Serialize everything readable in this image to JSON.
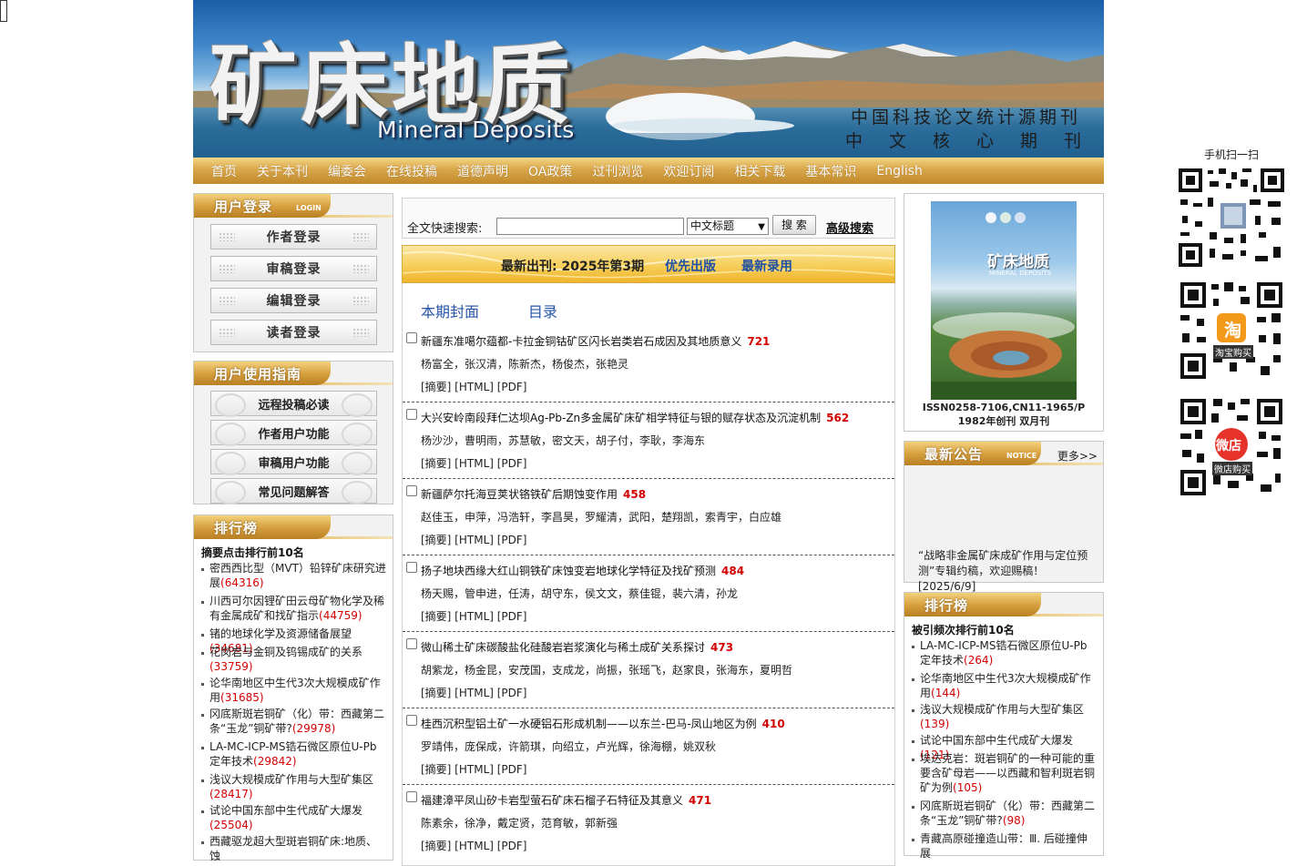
{
  "banner": {
    "title": "矿床地质",
    "english": "Mineral Deposits",
    "line1": "中国科技论文统计源期刊",
    "line2": "中文核心期刊"
  },
  "nav": [
    "首页",
    "关于本刊",
    "编委会",
    "在线投稿",
    "道德声明",
    "OA政策",
    "过刊浏览",
    "欢迎订阅",
    "相关下载",
    "基本常识",
    "English"
  ],
  "login_panel": {
    "title": "用户登录",
    "title_sub": "LOGIN",
    "buttons": [
      "作者登录",
      "审稿登录",
      "编辑登录",
      "读者登录"
    ]
  },
  "guide_panel": {
    "title": "用户使用指南",
    "buttons": [
      "远程投稿必读",
      "作者用户功能",
      "审稿用户功能",
      "常见问题解答"
    ]
  },
  "left_rank": {
    "title": "排行榜",
    "subtitle": "摘要点击排行前10名",
    "items": [
      {
        "text": "密西西比型（MVT）铅锌矿床研究进展",
        "count": "(64316)"
      },
      {
        "text": "川西可尔因锂矿田云母矿物化学及稀有金属成矿和找矿指示",
        "count": "(44759)"
      },
      {
        "text": "锗的地球化学及资源储备展望",
        "count": "(34681)"
      },
      {
        "text": "花岗岩与金铜及钨锡成矿的关系",
        "count": "(33759)"
      },
      {
        "text": "论华南地区中生代3次大规模成矿作用",
        "count": "(31685)"
      },
      {
        "text": "冈底斯斑岩铜矿（化）带：西藏第二条“玉龙”铜矿带?",
        "count": "(29978)"
      },
      {
        "text": "LA-MC-ICP-MS锆石微区原位U-Pb定年技术",
        "count": "(29842)"
      },
      {
        "text": "浅议大规模成矿作用与大型矿集区",
        "count": "(28417)"
      },
      {
        "text": "试论中国东部中生代成矿大爆发",
        "count": "(25504)"
      },
      {
        "text": "西藏驱龙超大型斑岩铜矿床:地质、蚀",
        "count": ""
      }
    ]
  },
  "search": {
    "label": "全文快速搜索:",
    "input_value": "",
    "select_value": "中文标题",
    "button": "搜 索",
    "advanced": "高级搜索"
  },
  "issue": {
    "latest": "最新出刊: 2025年第3期",
    "priority": "优先出版",
    "accepted": "最新录用"
  },
  "toc_tabs": [
    "本期封面",
    "目录"
  ],
  "articles": [
    {
      "title": "新疆东准噶尔蕴都-卡拉金铜钴矿区闪长岩类岩石成因及其地质意义",
      "views": "721",
      "authors": "杨富全，张汉清，陈新杰，杨俊杰，张艳灵",
      "links": "[摘要] [HTML] [PDF]"
    },
    {
      "title": "大兴安岭南段拜仁达坝Ag-Pb-Zn多金属矿床矿相学特征与银的赋存状态及沉淀机制",
      "views": "562",
      "authors": "杨沙沙，曹明雨，苏慧敏，密文天，胡子付，李耿，李海东",
      "links": "[摘要] [HTML] [PDF]"
    },
    {
      "title": "新疆萨尔托海豆荚状铬铁矿后期蚀变作用",
      "views": "458",
      "authors": "赵佳玉，申萍，冯浩轩，李昌昊，罗耀清，武阳，楚翔凯，索青宇，白应雄",
      "links": "[摘要] [HTML] [PDF]"
    },
    {
      "title": "扬子地块西缘大红山铜铁矿床蚀变岩地球化学特征及找矿预测",
      "views": "484",
      "authors": "杨天赐，管申进，任涛，胡守东，侯文文，蔡佳锟，裴六清，孙龙",
      "links": "[摘要] [HTML] [PDF]"
    },
    {
      "title": "微山稀土矿床碳酸盐化硅酸岩岩浆演化与稀土成矿关系探讨",
      "views": "473",
      "authors": "胡紫龙，杨金昆，安茂国，支成龙，尚振，张瑶飞，赵家良，张海东，夏明哲",
      "links": "[摘要] [HTML] [PDF]"
    },
    {
      "title": "桂西沉积型铝土矿一水硬铝石形成机制——以东兰-巴马-凤山地区为例",
      "views": "410",
      "authors": "罗靖伟，庞保成，许箭琪，向绍立，卢光辉，徐海棚，姚双秋",
      "links": "[摘要] [HTML] [PDF]"
    },
    {
      "title": "福建漳平凤山矽卡岩型萤石矿床石榴子石特征及其意义",
      "views": "471",
      "authors": "陈素余，徐净，戴定贤，范育敏，郭新强",
      "links": "[摘要] [HTML] [PDF]"
    }
  ],
  "cover": {
    "title": "矿床地质",
    "subtitle": "MINERAL DEPOSITS",
    "issn": "ISSN0258-7106,CN11-1965/P",
    "founded": "1982年创刊 双月刊"
  },
  "notice": {
    "title": "最新公告",
    "title_sub": "NOTICE",
    "more": "更多>>",
    "text": "“战略非金属矿床成矿作用与定位预测”专辑约稿，欢迎赐稿！ [2025/6/9]"
  },
  "right_rank": {
    "title": "排行榜",
    "subtitle": "被引频次排行前10名",
    "items": [
      {
        "text": "LA-MC-ICP-MS锆石微区原位U-Pb定年技术",
        "count": "(264)"
      },
      {
        "text": "论华南地区中生代3次大规模成矿作用",
        "count": "(144)"
      },
      {
        "text": "浅议大规模成矿作用与大型矿集区",
        "count": "(139)"
      },
      {
        "text": "试论中国东部中生代成矿大爆发",
        "count": "(121)"
      },
      {
        "text": "埃达克岩：斑岩铜矿的一种可能的重要含矿母岩——以西藏和智利斑岩铜矿为例",
        "count": "(105)"
      },
      {
        "text": "冈底斯斑岩铜矿（化）带：西藏第二条“玉龙”铜矿带?",
        "count": "(98)"
      },
      {
        "text": "青藏高原碰撞造山带：Ⅲ. 后碰撞伸展",
        "count": ""
      }
    ]
  },
  "qr": {
    "label": "手机扫一扫",
    "taobao_badge": "淘",
    "taobao_caption": "淘宝购买",
    "weidian_badge": "微店",
    "weidian_caption": "微店购买"
  },
  "colors": {
    "nav_gold": "#d9a64a",
    "link_blue": "#1d4fa6",
    "count_red": "#d40000"
  }
}
